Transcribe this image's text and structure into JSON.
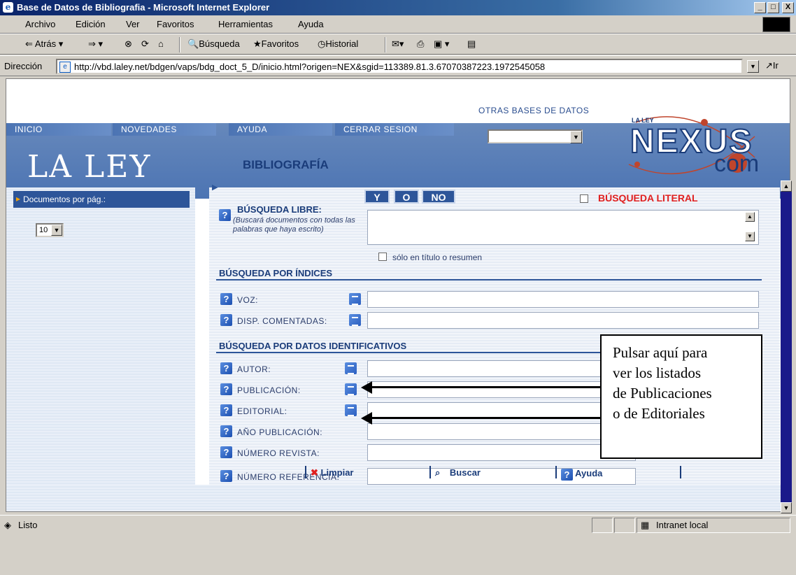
{
  "window": {
    "title": "Base de Datos de Bibliografia - Microsoft Internet Explorer",
    "buttons": {
      "minimize": "_",
      "maximize": "□",
      "close": "X"
    }
  },
  "menu": [
    "Archivo",
    "Edición",
    "Ver",
    "Favoritos",
    "Herramientas",
    "Ayuda"
  ],
  "toolbar": {
    "back": "Atrás",
    "search": "Búsqueda",
    "favorites": "Favoritos",
    "history": "Historial"
  },
  "address": {
    "label": "Dirección",
    "url": "http://vbd.laley.net/bdgen/vaps/bdg_doct_5_D/inicio.html?origen=NEX&sgid=113389.81.3.67070387223.1972545058",
    "go": "Ir"
  },
  "header": {
    "nav": [
      "INICIO",
      "NOVEDADES",
      "AYUDA",
      "CERRAR SESION"
    ],
    "otras_bases": "OTRAS BASES DE DATOS",
    "brand": "LA LEY",
    "section": "BIBLIOGRAFÍA",
    "nexus_small": "LA LEY",
    "nexus": "NEXUS",
    "nexus_com": "com"
  },
  "sidebar": {
    "docs_label": "Documentos por pág.:",
    "docs_value": "10"
  },
  "form": {
    "bool_ops": [
      "Y",
      "O",
      "NO"
    ],
    "literal_label": "BÚSQUEDA LITERAL",
    "libre_title": "BÚSQUEDA LIBRE:",
    "libre_help": "(Buscará documentos con todas las palabras que haya escrito)",
    "title_only": "sólo en título o resumen",
    "indices_title": "BÚSQUEDA POR ÍNDICES",
    "indices_fields": [
      "VOZ:",
      "DISP. COMENTADAS:"
    ],
    "datos_title": "BÚSQUEDA POR DATOS IDENTIFICATIVOS",
    "datos_fields": [
      "AUTOR:",
      "PUBLICACIÓN:",
      "EDITORIAL:",
      "AÑO PUBLICACIÓN:",
      "NÚMERO REVISTA:",
      "NÚMERO REFERENCIA:"
    ]
  },
  "callout": {
    "lines": [
      "Pulsar aquí para",
      "ver los listados",
      "de Publicaciones",
      "o de Editoriales"
    ]
  },
  "actions": {
    "clear": "Limpiar",
    "search": "Buscar",
    "help": "Ayuda"
  },
  "status": {
    "text": "Listo",
    "zone": "Intranet local"
  },
  "colors": {
    "accent": "#2d5599",
    "title_bar": "#0a246a",
    "literal_red": "#e02020"
  }
}
